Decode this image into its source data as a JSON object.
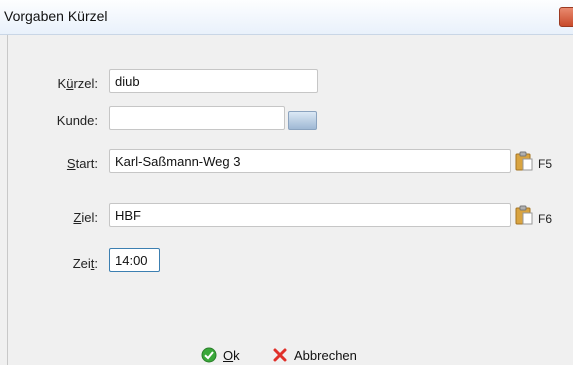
{
  "window": {
    "title": "Vorgaben Kürzel"
  },
  "form": {
    "kuerzel": {
      "label_pre": "K",
      "label_acc": "ü",
      "label_post": "rzel:",
      "value": "diub"
    },
    "kunde": {
      "label": "Kunde:",
      "value": ""
    },
    "start": {
      "label_acc": "S",
      "label_post": "tart:",
      "value": "Karl-Saßmann-Weg 3",
      "shortcut": "F5"
    },
    "ziel": {
      "label_acc": "Z",
      "label_post": "iel:",
      "value": "HBF",
      "shortcut": "F6"
    },
    "zeit": {
      "label_pre": "Zei",
      "label_acc": "t",
      "label_post": ":",
      "value": "14:00"
    }
  },
  "footer": {
    "ok": {
      "label_acc": "O",
      "label_post": "k"
    },
    "cancel": {
      "label": "Abbrechen"
    }
  },
  "icons": [
    "close-icon",
    "keyboard-icon",
    "clipboard-icon",
    "check-icon",
    "cross-icon"
  ],
  "colors": {
    "ok_icon": "#3aa83a",
    "cancel_icon": "#e0302a",
    "clipboard": "#d9a441"
  }
}
